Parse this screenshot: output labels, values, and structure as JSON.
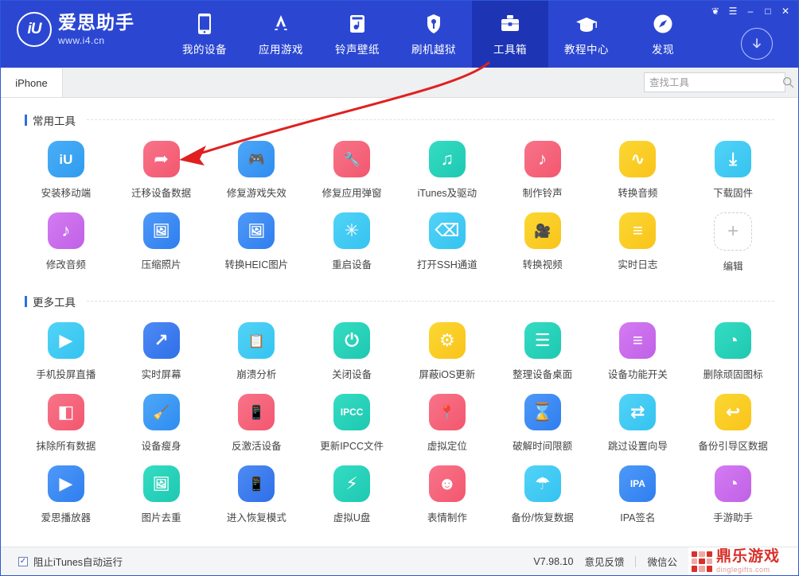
{
  "window": {
    "controls": [
      {
        "name": "skin-button",
        "glyph": "❦"
      },
      {
        "name": "menu-button",
        "glyph": "☰"
      },
      {
        "name": "minimize-button",
        "glyph": "–"
      },
      {
        "name": "maximize-button",
        "glyph": "□"
      },
      {
        "name": "close-button",
        "glyph": "✕"
      }
    ],
    "download_icon": "download-arrow-icon"
  },
  "brand": {
    "mark": "iU",
    "title": "爱思助手",
    "subtitle": "www.i4.cn"
  },
  "nav": {
    "items": [
      {
        "label": "我的设备",
        "icon": "phone-icon",
        "active": false
      },
      {
        "label": "应用游戏",
        "icon": "appstore-icon",
        "active": false
      },
      {
        "label": "铃声壁纸",
        "icon": "ringtone-wallpaper-icon",
        "active": false
      },
      {
        "label": "刷机越狱",
        "icon": "flash-jailbreak-icon",
        "active": false
      },
      {
        "label": "工具箱",
        "icon": "toolbox-icon",
        "active": true
      },
      {
        "label": "教程中心",
        "icon": "graduation-cap-icon",
        "active": false
      },
      {
        "label": "发现",
        "icon": "compass-icon",
        "active": false
      }
    ]
  },
  "tabs": [
    {
      "label": "iPhone",
      "active": true
    }
  ],
  "search": {
    "placeholder": "查找工具",
    "value": "",
    "icon": "search-icon"
  },
  "sections": [
    {
      "title": "常用工具",
      "tools": [
        {
          "label": "安装移动端",
          "icon": "iu-install-icon",
          "bg": "#2f9bef",
          "bg2": "#4aaef6",
          "glyph": "iU"
        },
        {
          "label": "迁移设备数据",
          "icon": "migrate-data-icon",
          "bg": "#f2576f",
          "bg2": "#f87489",
          "glyph": "➦"
        },
        {
          "label": "修复游戏失效",
          "icon": "gamepad-fix-icon",
          "bg": "#2f8cf0",
          "bg2": "#4ea7f8",
          "glyph": "🎮"
        },
        {
          "label": "修复应用弹窗",
          "icon": "app-popup-fix-icon",
          "bg": "#f2576f",
          "bg2": "#f87489",
          "glyph": "🔧"
        },
        {
          "label": "iTunes及驱动",
          "icon": "itunes-driver-icon",
          "bg": "#1ec8b0",
          "bg2": "#35dcc4",
          "glyph": "♫"
        },
        {
          "label": "制作铃声",
          "icon": "make-ringtone-icon",
          "bg": "#f2576f",
          "bg2": "#f87489",
          "glyph": "♪"
        },
        {
          "label": "转换音频",
          "icon": "convert-audio-icon",
          "bg": "#f9c41a",
          "bg2": "#fbd733",
          "glyph": "∿"
        },
        {
          "label": "下载固件",
          "icon": "download-firmware-icon",
          "bg": "#34c3f0",
          "bg2": "#52d3f7",
          "glyph": "⤓"
        },
        {
          "label": "修改音频",
          "icon": "edit-audio-icon",
          "bg": "#c061e6",
          "bg2": "#d47bf2",
          "glyph": "♪"
        },
        {
          "label": "压缩照片",
          "icon": "compress-photo-icon",
          "bg": "#2f7eef",
          "bg2": "#4e99f8",
          "glyph": "🖼"
        },
        {
          "label": "转换HEIC图片",
          "icon": "convert-heic-icon",
          "bg": "#2f7eef",
          "bg2": "#4e99f8",
          "glyph": "🖼"
        },
        {
          "label": "重启设备",
          "icon": "reboot-device-icon",
          "bg": "#34c3f0",
          "bg2": "#52d3f7",
          "glyph": "✳"
        },
        {
          "label": "打开SSH通道",
          "icon": "ssh-tunnel-icon",
          "bg": "#34c3f0",
          "bg2": "#52d3f7",
          "glyph": "⌫"
        },
        {
          "label": "转换视频",
          "icon": "convert-video-icon",
          "bg": "#f9c41a",
          "bg2": "#fbd733",
          "glyph": "🎥"
        },
        {
          "label": "实时日志",
          "icon": "realtime-log-icon",
          "bg": "#f9c41a",
          "bg2": "#fbd733",
          "glyph": "≡"
        },
        {
          "label": "编辑",
          "icon": "edit-add-icon",
          "bg": "",
          "bg2": "",
          "glyph": "+"
        }
      ]
    },
    {
      "title": "更多工具",
      "tools": [
        {
          "label": "手机投屏直播",
          "icon": "screen-cast-icon",
          "bg": "#34c3f0",
          "bg2": "#52d3f7",
          "glyph": "▶"
        },
        {
          "label": "实时屏幕",
          "icon": "realtime-screen-icon",
          "bg": "#2f6fe8",
          "bg2": "#4d8bf4",
          "glyph": "↗"
        },
        {
          "label": "崩溃分析",
          "icon": "crash-analysis-icon",
          "bg": "#34c3f0",
          "bg2": "#52d3f7",
          "glyph": "📋"
        },
        {
          "label": "关闭设备",
          "icon": "power-off-icon",
          "bg": "#1ec8b0",
          "bg2": "#35dcc4",
          "glyph": "⏻"
        },
        {
          "label": "屏蔽iOS更新",
          "icon": "block-ios-update-icon",
          "bg": "#f9c41a",
          "bg2": "#fbd733",
          "glyph": "⚙"
        },
        {
          "label": "整理设备桌面",
          "icon": "organize-desktop-icon",
          "bg": "#1ec8b0",
          "bg2": "#35dcc4",
          "glyph": "☰"
        },
        {
          "label": "设备功能开关",
          "icon": "feature-toggle-icon",
          "bg": "#c061e6",
          "bg2": "#d47bf2",
          "glyph": "≡"
        },
        {
          "label": "删除顽固图标",
          "icon": "remove-icon-icon",
          "bg": "#1ec8b0",
          "bg2": "#35dcc4",
          "glyph": "◔"
        },
        {
          "label": "抹除所有数据",
          "icon": "erase-all-data-icon",
          "bg": "#f2576f",
          "bg2": "#f87489",
          "glyph": "◧"
        },
        {
          "label": "设备瘦身",
          "icon": "device-cleanup-icon",
          "bg": "#2f8cf0",
          "bg2": "#4ea7f8",
          "glyph": "🧹"
        },
        {
          "label": "反激活设备",
          "icon": "deactivate-device-icon",
          "bg": "#f2576f",
          "bg2": "#f87489",
          "glyph": "📱"
        },
        {
          "label": "更新IPCC文件",
          "icon": "update-ipcc-icon",
          "bg": "#1ec8b0",
          "bg2": "#35dcc4",
          "glyph": "IPCC"
        },
        {
          "label": "虚拟定位",
          "icon": "virtual-location-icon",
          "bg": "#f2576f",
          "bg2": "#f87489",
          "glyph": "📍"
        },
        {
          "label": "破解时间限额",
          "icon": "crack-time-limit-icon",
          "bg": "#2f7eef",
          "bg2": "#4e99f8",
          "glyph": "⌛"
        },
        {
          "label": "跳过设置向导",
          "icon": "skip-setup-icon",
          "bg": "#34c3f0",
          "bg2": "#52d3f7",
          "glyph": "⇄"
        },
        {
          "label": "备份引导区数据",
          "icon": "backup-boot-icon",
          "bg": "#f9c41a",
          "bg2": "#fbd733",
          "glyph": "↩"
        },
        {
          "label": "爱思播放器",
          "icon": "i4-player-icon",
          "bg": "#2f7eef",
          "bg2": "#4e99f8",
          "glyph": "▶"
        },
        {
          "label": "图片去重",
          "icon": "photo-dedupe-icon",
          "bg": "#1ec8b0",
          "bg2": "#35dcc4",
          "glyph": "🖼"
        },
        {
          "label": "进入恢复模式",
          "icon": "recovery-mode-icon",
          "bg": "#2f6fe8",
          "bg2": "#4d8bf4",
          "glyph": "📱"
        },
        {
          "label": "虚拟U盘",
          "icon": "virtual-usb-icon",
          "bg": "#1ec8b0",
          "bg2": "#35dcc4",
          "glyph": "⚡"
        },
        {
          "label": "表情制作",
          "icon": "emoji-maker-icon",
          "bg": "#f2576f",
          "bg2": "#f87489",
          "glyph": "☻"
        },
        {
          "label": "备份/恢复数据",
          "icon": "backup-restore-icon",
          "bg": "#34c3f0",
          "bg2": "#52d3f7",
          "glyph": "☂"
        },
        {
          "label": "IPA签名",
          "icon": "ipa-sign-icon",
          "bg": "#2f7eef",
          "bg2": "#4e99f8",
          "glyph": "IPA"
        },
        {
          "label": "手游助手",
          "icon": "mobile-game-helper-icon",
          "bg": "#c061e6",
          "bg2": "#d47bf2",
          "glyph": "◔"
        }
      ]
    }
  ],
  "footer": {
    "checkbox_label": "阻止iTunes自动运行",
    "checkbox_checked": true,
    "version": "V7.98.10",
    "feedback": "意见反馈",
    "wechat": "微信公",
    "watermark_main": "鼎乐游戏",
    "watermark_sub": "dinglegifts.com"
  },
  "annotation": {
    "type": "red-curved-arrow",
    "color": "#e02020",
    "from": "工具箱",
    "to": "迁移设备数据"
  }
}
